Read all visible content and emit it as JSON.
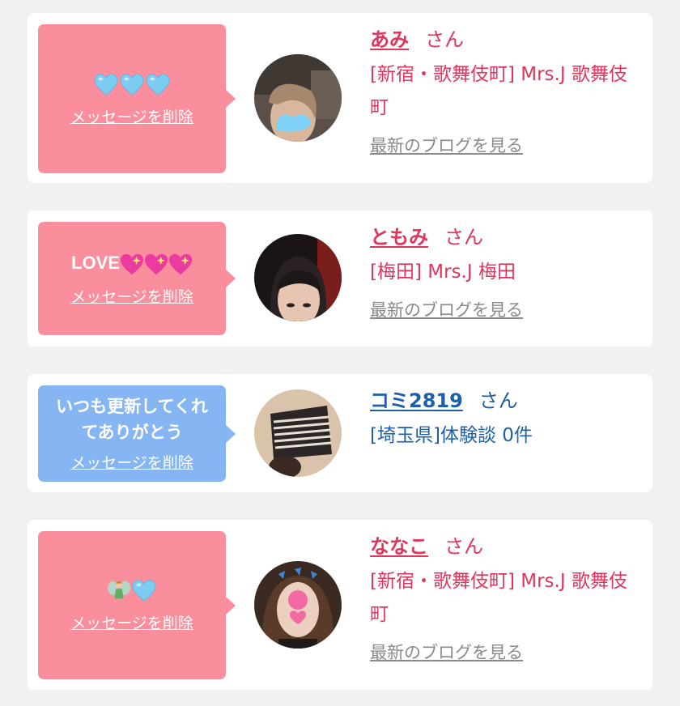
{
  "delete_label": "メッセージを削除",
  "blog_label": "最新のブログを見る",
  "honorific": "さん",
  "colors": {
    "pink_bubble": "#fb8e9d",
    "blue_bubble": "#86b5f4",
    "pink_text": "#e0365c",
    "blue_text": "#1d5fa8",
    "link_gray": "#8a8a8a"
  },
  "messages": [
    {
      "message_emoji": [
        "blue-heart",
        "blue-heart",
        "blue-heart"
      ],
      "name": "あみ",
      "shop": "[新宿・歌舞伎町] Mrs.J 歌舞伎町"
    },
    {
      "message_text": "LOVE",
      "message_emoji": [
        "sparkling-heart",
        "sparkling-heart",
        "sparkling-heart"
      ],
      "name": "ともみ",
      "shop": "[梅田] Mrs.J 梅田"
    },
    {
      "message_text": "いつも更新してくれてありがとう",
      "name": "コミ2819",
      "shop": "[埼玉県]体験談 0件"
    },
    {
      "message_emoji": [
        "fairy",
        "blue-heart"
      ],
      "name": "ななこ",
      "shop": "[新宿・歌舞伎町] Mrs.J 歌舞伎町"
    }
  ]
}
